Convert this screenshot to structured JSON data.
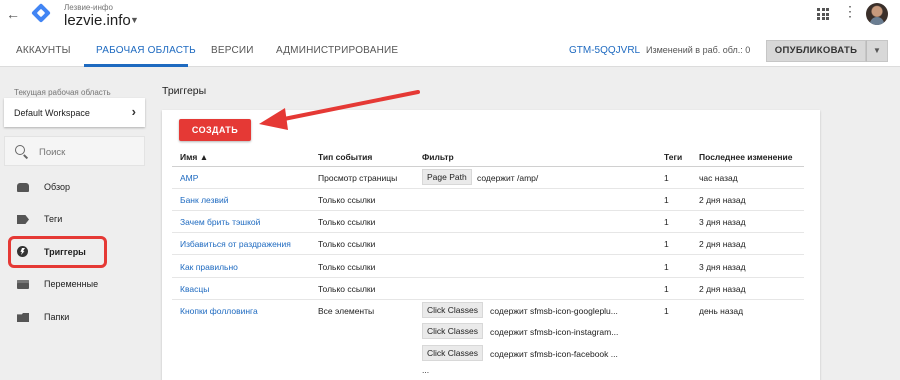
{
  "topbar": {
    "account_label": "Лезвие-инфо",
    "container_name": "lezvie.info",
    "back_icon": "arrow-back-icon",
    "apps_icon": "apps-grid-icon",
    "more_icon": "more-vert-icon"
  },
  "tabs": [
    {
      "label": "АККАУНТЫ",
      "active": false
    },
    {
      "label": "РАБОЧАЯ ОБЛАСТЬ",
      "active": true
    },
    {
      "label": "ВЕРСИИ",
      "active": false
    },
    {
      "label": "АДМИНИСТРИРОВАНИЕ",
      "active": false
    }
  ],
  "header_right": {
    "container_id": "GTM-5QQJVRL",
    "changes": "Изменений в раб. обл.: 0",
    "publish_label": "ОПУБЛИКОВАТЬ"
  },
  "sidebar": {
    "workspace_label": "Текущая рабочая область",
    "workspace_name": "Default Workspace",
    "search_placeholder": "Поиск",
    "items": [
      {
        "label": "Обзор",
        "icon": "overview-icon"
      },
      {
        "label": "Теги",
        "icon": "tag-icon"
      },
      {
        "label": "Триггеры",
        "icon": "trigger-icon",
        "active": true
      },
      {
        "label": "Переменные",
        "icon": "variables-icon"
      },
      {
        "label": "Папки",
        "icon": "folder-icon"
      }
    ]
  },
  "main": {
    "title": "Триггеры",
    "create_label": "СОЗДАТЬ",
    "columns": {
      "name": "Имя",
      "event_type": "Тип события",
      "filter": "Фильтр",
      "tags": "Теги",
      "last_modified": "Последнее изменение"
    },
    "rows": [
      {
        "name": "AMP",
        "event_type": "Просмотр страницы",
        "filters": [
          {
            "var": "Page Path",
            "cond": "содержит /amp/"
          }
        ],
        "tags": "1",
        "modified": "час назад"
      },
      {
        "name": "Банк лезвий",
        "event_type": "Только ссылки",
        "filters": [],
        "tags": "1",
        "modified": "2 дня назад"
      },
      {
        "name": "Зачем брить тэшкой",
        "event_type": "Только ссылки",
        "filters": [],
        "tags": "1",
        "modified": "3 дня назад"
      },
      {
        "name": "Избавиться от раздражения",
        "event_type": "Только ссылки",
        "filters": [],
        "tags": "1",
        "modified": "2 дня назад"
      },
      {
        "name": "Как правильно",
        "event_type": "Только ссылки",
        "filters": [],
        "tags": "1",
        "modified": "3 дня назад"
      },
      {
        "name": "Квасцы",
        "event_type": "Только ссылки",
        "filters": [],
        "tags": "1",
        "modified": "2 дня назад"
      },
      {
        "name": "Кнопки фолловинга",
        "event_type": "Все элементы",
        "filters": [
          {
            "var": "Click Classes",
            "cond": "содержит sfmsb-icon-googleplu..."
          },
          {
            "var": "Click Classes",
            "cond": "содержит sfmsb-icon-instagram..."
          },
          {
            "var": "Click Classes",
            "cond": "содержит sfmsb-icon-facebook ..."
          }
        ],
        "filters_more": "...",
        "tags": "1",
        "modified": "день назад"
      }
    ]
  },
  "colors": {
    "accent_blue": "#1e6ac0",
    "create_red": "#e53935",
    "annotation_red": "#e53935"
  }
}
